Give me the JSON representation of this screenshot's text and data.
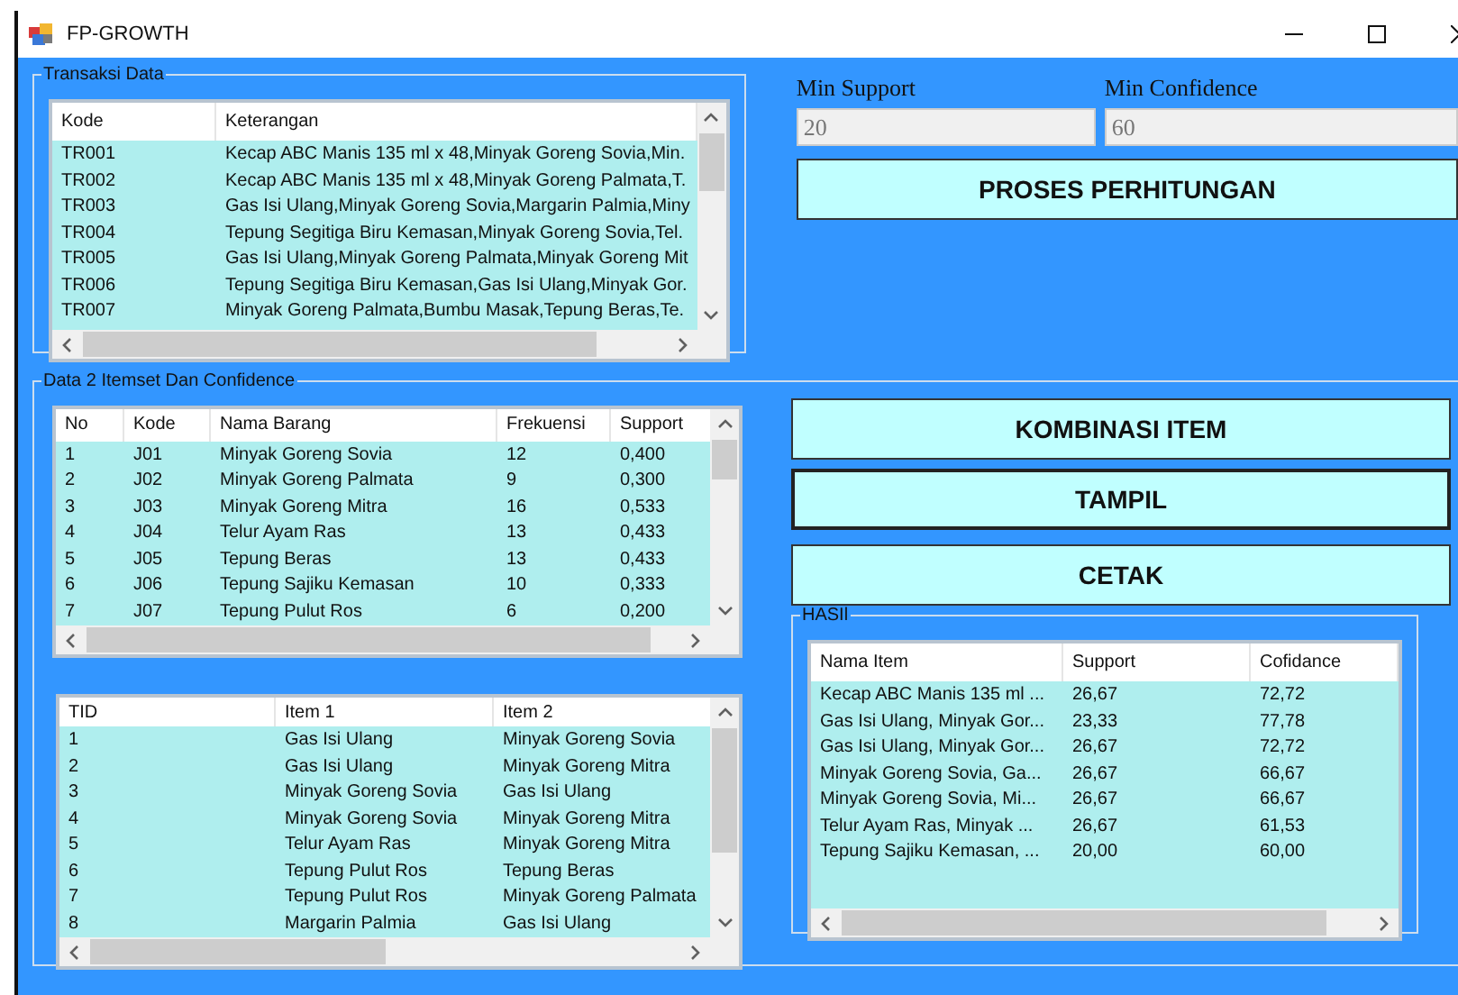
{
  "window": {
    "title": "FP-GROWTH"
  },
  "transaction_group": {
    "title": "Transaksi Data",
    "table": {
      "columns": [
        "Kode",
        "Keterangan"
      ],
      "rows": [
        [
          "TR001",
          "Kecap ABC Manis 135 ml x 48,Minyak Goreng Sovia,Min."
        ],
        [
          "TR002",
          "Kecap ABC Manis 135 ml x 48,Minyak Goreng Palmata,T."
        ],
        [
          "TR003",
          "Gas Isi Ulang,Minyak Goreng Sovia,Margarin Palmia,Miny"
        ],
        [
          "TR004",
          "Tepung Segitiga Biru Kemasan,Minyak Goreng Sovia,Tel."
        ],
        [
          "TR005",
          "Gas Isi Ulang,Minyak Goreng Palmata,Minyak Goreng Mit"
        ],
        [
          "TR006",
          "Tepung Segitiga Biru Kemasan,Gas Isi Ulang,Minyak Gor."
        ],
        [
          "TR007",
          "Minyak Goreng Palmata,Bumbu Masak,Tepung Beras,Te."
        ]
      ]
    }
  },
  "min_support": {
    "label": "Min Support",
    "value": "20"
  },
  "min_confidence": {
    "label": "Min Confidence",
    "value": "60"
  },
  "process_button": "PROSES PERHITUNGAN",
  "itemset_group": {
    "title": "Data 2 Itemset Dan Confidence",
    "items_table": {
      "columns": [
        "No",
        "Kode",
        "Nama Barang",
        "Frekuensi",
        "Support"
      ],
      "rows": [
        [
          "1",
          "J01",
          "Minyak Goreng Sovia",
          "12",
          "0,400"
        ],
        [
          "2",
          "J02",
          "Minyak Goreng Palmata",
          "9",
          "0,300"
        ],
        [
          "3",
          "J03",
          "Minyak Goreng Mitra",
          "16",
          "0,533"
        ],
        [
          "4",
          "J04",
          "Telur Ayam Ras",
          "13",
          "0,433"
        ],
        [
          "5",
          "J05",
          "Tepung Beras",
          "13",
          "0,433"
        ],
        [
          "6",
          "J06",
          "Tepung Sajiku Kemasan",
          "10",
          "0,333"
        ],
        [
          "7",
          "J07",
          "Tepung Pulut Ros",
          "6",
          "0,200"
        ]
      ]
    },
    "pairs_table": {
      "columns": [
        "TID",
        "Item 1",
        "Item 2"
      ],
      "rows": [
        [
          "1",
          "Gas Isi Ulang",
          "Minyak Goreng Sovia"
        ],
        [
          "2",
          "Gas Isi Ulang",
          "Minyak Goreng Mitra"
        ],
        [
          "3",
          "Minyak Goreng Sovia",
          "Gas Isi Ulang"
        ],
        [
          "4",
          "Minyak Goreng Sovia",
          "Minyak Goreng Mitra"
        ],
        [
          "5",
          "Telur Ayam Ras",
          "Minyak Goreng Mitra"
        ],
        [
          "6",
          "Tepung Pulut Ros",
          "Tepung Beras"
        ],
        [
          "7",
          "Tepung Pulut Ros",
          "Minyak Goreng Palmata"
        ],
        [
          "8",
          "Margarin Palmia",
          "Gas Isi Ulang"
        ]
      ]
    },
    "buttons": [
      "KOMBINASI ITEM",
      "TAMPIL",
      "CETAK"
    ],
    "result_group": {
      "title": "HASIl",
      "table": {
        "columns": [
          "Nama Item",
          "Support",
          "Cofidance"
        ],
        "rows": [
          [
            "Kecap ABC Manis 135 ml ...",
            "26,67",
            "72,72"
          ],
          [
            "Gas Isi Ulang, Minyak Gor...",
            "23,33",
            "77,78"
          ],
          [
            "Gas Isi Ulang, Minyak Gor...",
            "26,67",
            "72,72"
          ],
          [
            "Minyak Goreng Sovia, Ga...",
            "26,67",
            "66,67"
          ],
          [
            "Minyak Goreng Sovia, Mi...",
            "26,67",
            "66,67"
          ],
          [
            "Telur Ayam Ras, Minyak ...",
            "26,67",
            "61,53"
          ],
          [
            "Tepung Sajiku Kemasan, ...",
            "20,00",
            "60,00"
          ]
        ]
      }
    }
  }
}
